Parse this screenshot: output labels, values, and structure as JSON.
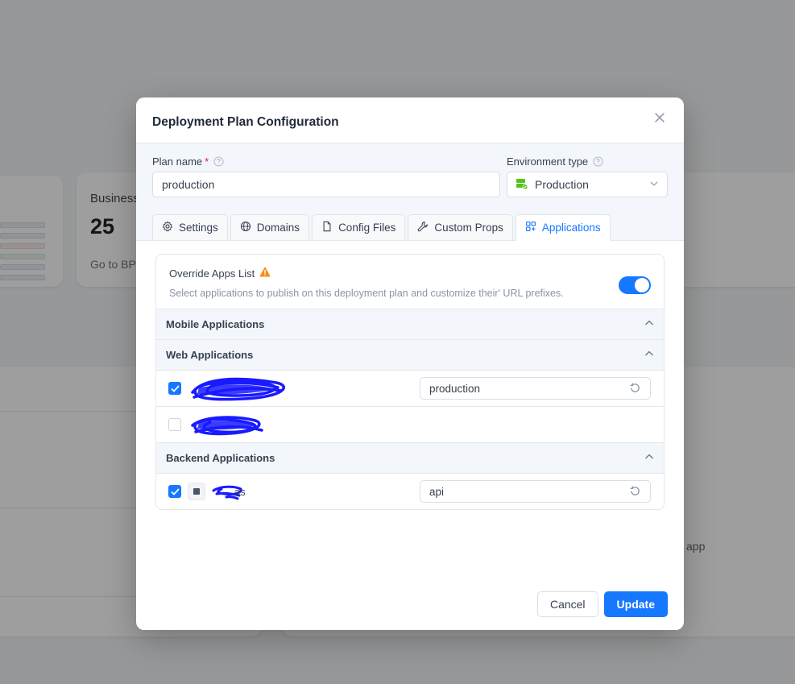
{
  "background": {
    "card_label": "Business",
    "card_value": "25",
    "card_link": "Go to BP",
    "side_text": "app"
  },
  "modal": {
    "title": "Deployment Plan Configuration",
    "plan_name": {
      "label": "Plan name",
      "required_mark": "*",
      "value": "production"
    },
    "environment_type": {
      "label": "Environment type",
      "value": "Production",
      "icon": "server-status-icon"
    },
    "tabs": [
      {
        "label": "Settings",
        "icon": "gear-icon",
        "active": false
      },
      {
        "label": "Domains",
        "icon": "globe-icon",
        "active": false
      },
      {
        "label": "Config Files",
        "icon": "file-icon",
        "active": false
      },
      {
        "label": "Custom Props",
        "icon": "wrench-icon",
        "active": false
      },
      {
        "label": "Applications",
        "icon": "apps-icon",
        "active": true
      }
    ],
    "override": {
      "title": "Override Apps List",
      "description": "Select applications to publish on this deployment plan and customize their' URL prefixes.",
      "enabled": true
    },
    "sections": [
      {
        "title": "Mobile Applications",
        "expanded": true,
        "apps": []
      },
      {
        "title": "Web Applications",
        "expanded": true,
        "apps": [
          {
            "checked": true,
            "prefix": "production"
          },
          {
            "checked": false,
            "prefix": ""
          }
        ]
      },
      {
        "title": "Backend Applications",
        "expanded": true,
        "apps": [
          {
            "checked": true,
            "name_suffix": "as",
            "prefix": "api"
          }
        ]
      }
    ],
    "footer": {
      "cancel": "Cancel",
      "update": "Update"
    }
  },
  "colors": {
    "primary": "#1677ff",
    "warning": "#fa8c16",
    "redaction": "#1a1aff"
  }
}
